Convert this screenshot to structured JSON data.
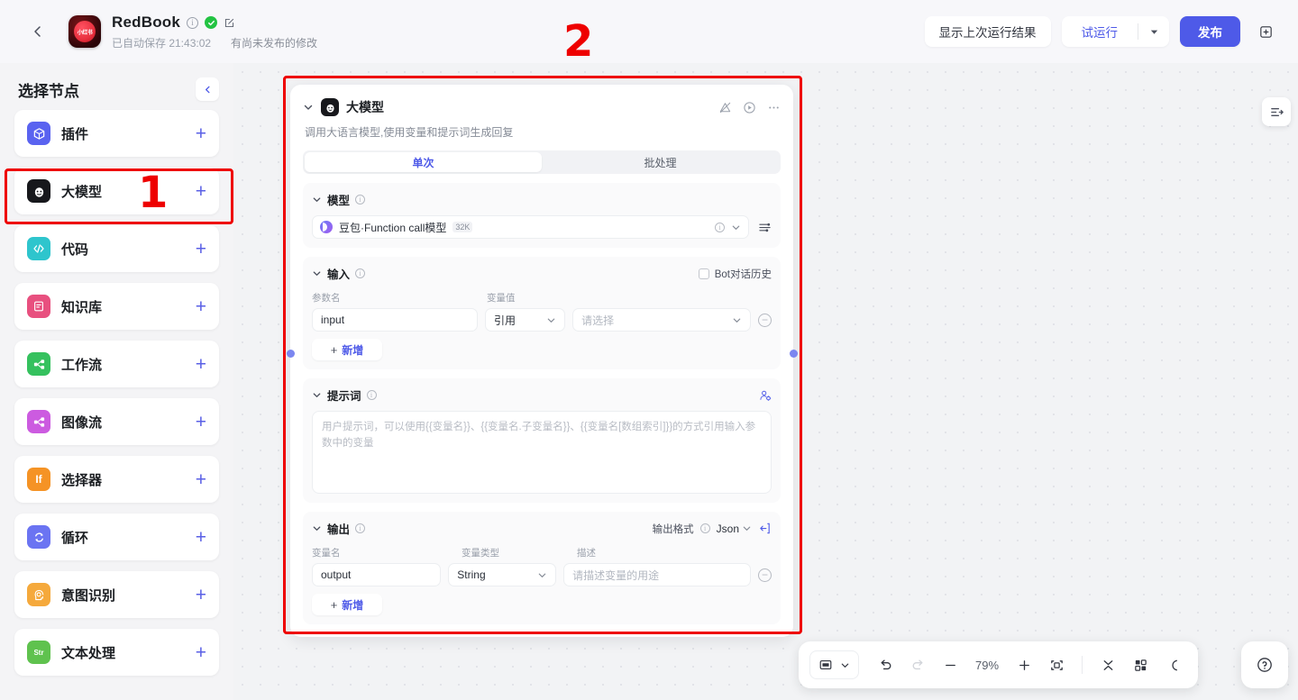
{
  "header": {
    "back_icon": "chevron-left-icon",
    "logo_text": "小红书",
    "app_title": "RedBook",
    "info_icon": "info-icon",
    "verified_icon": "check-circle-icon",
    "edit_icon": "edit-icon",
    "autosave_text": "已自动保存 21:43:02",
    "unpublished_text": "有尚未发布的修改",
    "show_last_result_label": "显示上次运行结果",
    "test_run_label": "试运行",
    "test_run_caret_icon": "caret-down-icon",
    "publish_label": "发布",
    "duplicate_icon": "duplicate-icon"
  },
  "sidebar": {
    "title": "选择节点",
    "collapse_icon": "chevron-left-icon",
    "items": [
      {
        "label": "插件",
        "icon": "plugin-icon",
        "color": "#5a63f0",
        "glyph": "cube",
        "add": "+"
      },
      {
        "label": "大模型",
        "icon": "llm-icon",
        "color": "#17181c",
        "glyph": "face",
        "add": "+"
      },
      {
        "label": "代码",
        "icon": "code-icon",
        "color": "#2ec5cd",
        "glyph": "code",
        "add": "+"
      },
      {
        "label": "知识库",
        "icon": "knowledge-icon",
        "color": "#e8507f",
        "glyph": "doc",
        "add": "+"
      },
      {
        "label": "工作流",
        "icon": "workflow-icon",
        "color": "#35c15e",
        "glyph": "share",
        "add": "+"
      },
      {
        "label": "图像流",
        "icon": "imageflow-icon",
        "color": "#cc5be0",
        "glyph": "share",
        "add": "+"
      },
      {
        "label": "选择器",
        "icon": "condition-icon",
        "color": "#f59325",
        "glyph": "If",
        "add": "+"
      },
      {
        "label": "循环",
        "icon": "loop-icon",
        "color": "#6b74f2",
        "glyph": "loop",
        "add": "+"
      },
      {
        "label": "意图识别",
        "icon": "intent-icon",
        "color": "#f5a93c",
        "glyph": "brain",
        "add": "+"
      },
      {
        "label": "文本处理",
        "icon": "text-process-icon",
        "color": "#5fc24e",
        "glyph": "Str",
        "add": "+"
      }
    ]
  },
  "node": {
    "collapse_icon": "chevron-down-icon",
    "badge_icon": "llm-avatar-icon",
    "title": "大模型",
    "tools": [
      "alert-off-icon",
      "play-circle-icon",
      "more-icon"
    ],
    "description": "调用大语言模型,使用变量和提示词生成回复",
    "tabs": [
      {
        "label": "单次",
        "active": true
      },
      {
        "label": "批处理",
        "active": false
      }
    ],
    "model_section": {
      "title": "模型",
      "info_icon": "info-icon",
      "provider_icon": "doubao-icon",
      "model_name": "豆包·Function call模型",
      "context_tag": "32K",
      "row_info_icon": "info-icon",
      "row_caret_icon": "caret-down-icon",
      "settings_icon": "sliders-icon"
    },
    "input_section": {
      "title": "输入",
      "info_icon": "info-icon",
      "bot_history_label": "Bot对话历史",
      "bot_history_checked": false,
      "columns": [
        "参数名",
        "变量值"
      ],
      "rows": [
        {
          "param_name": "input",
          "source_type": "引用",
          "value_placeholder": "请选择"
        }
      ],
      "add_label": "新增"
    },
    "prompt_section": {
      "title": "提示词",
      "info_icon": "info-icon",
      "person_icon": "person-settings-icon",
      "placeholder": "用户提示词，可以使用{{变量名}}、{{变量名.子变量名}}、{{变量名[数组索引]}}的方式引用输入参数中的变量",
      "value": ""
    },
    "output_section": {
      "title": "输出",
      "info_icon": "info-icon",
      "format_label": "输出格式",
      "format_info_icon": "info-icon",
      "format_value": "Json",
      "format_caret_icon": "caret-down-icon",
      "export_icon": "export-icon",
      "columns": [
        "变量名",
        "变量类型",
        "描述"
      ],
      "rows": [
        {
          "var_name": "output",
          "var_type": "String",
          "desc_placeholder": "请描述变量的用途"
        }
      ],
      "add_label": "新增"
    }
  },
  "right_panel": {
    "expand_icon": "panel-expand-icon"
  },
  "bottom_toolbar": {
    "mode_icon": "screen-icon",
    "mode_caret_icon": "caret-down-icon",
    "undo_icon": "undo-icon",
    "redo_icon": "redo-icon",
    "zoom_out_icon": "minus-icon",
    "zoom_level": "79%",
    "zoom_in_icon": "plus-icon",
    "fit_icon": "fit-screen-icon",
    "collapse_all_icon": "collapse-icon",
    "grid_icon": "grid-icon",
    "curve_icon": "curve-icon",
    "help_icon": "help-icon"
  },
  "annotations": [
    {
      "number": "1",
      "target": "sidebar-item-llm"
    },
    {
      "number": "2",
      "target": "llm-node-card"
    }
  ],
  "colors": {
    "accent": "#4e5ae8",
    "annotation": "#ee0000",
    "canvas_bg": "#f2f3f5",
    "success": "#23c343"
  }
}
